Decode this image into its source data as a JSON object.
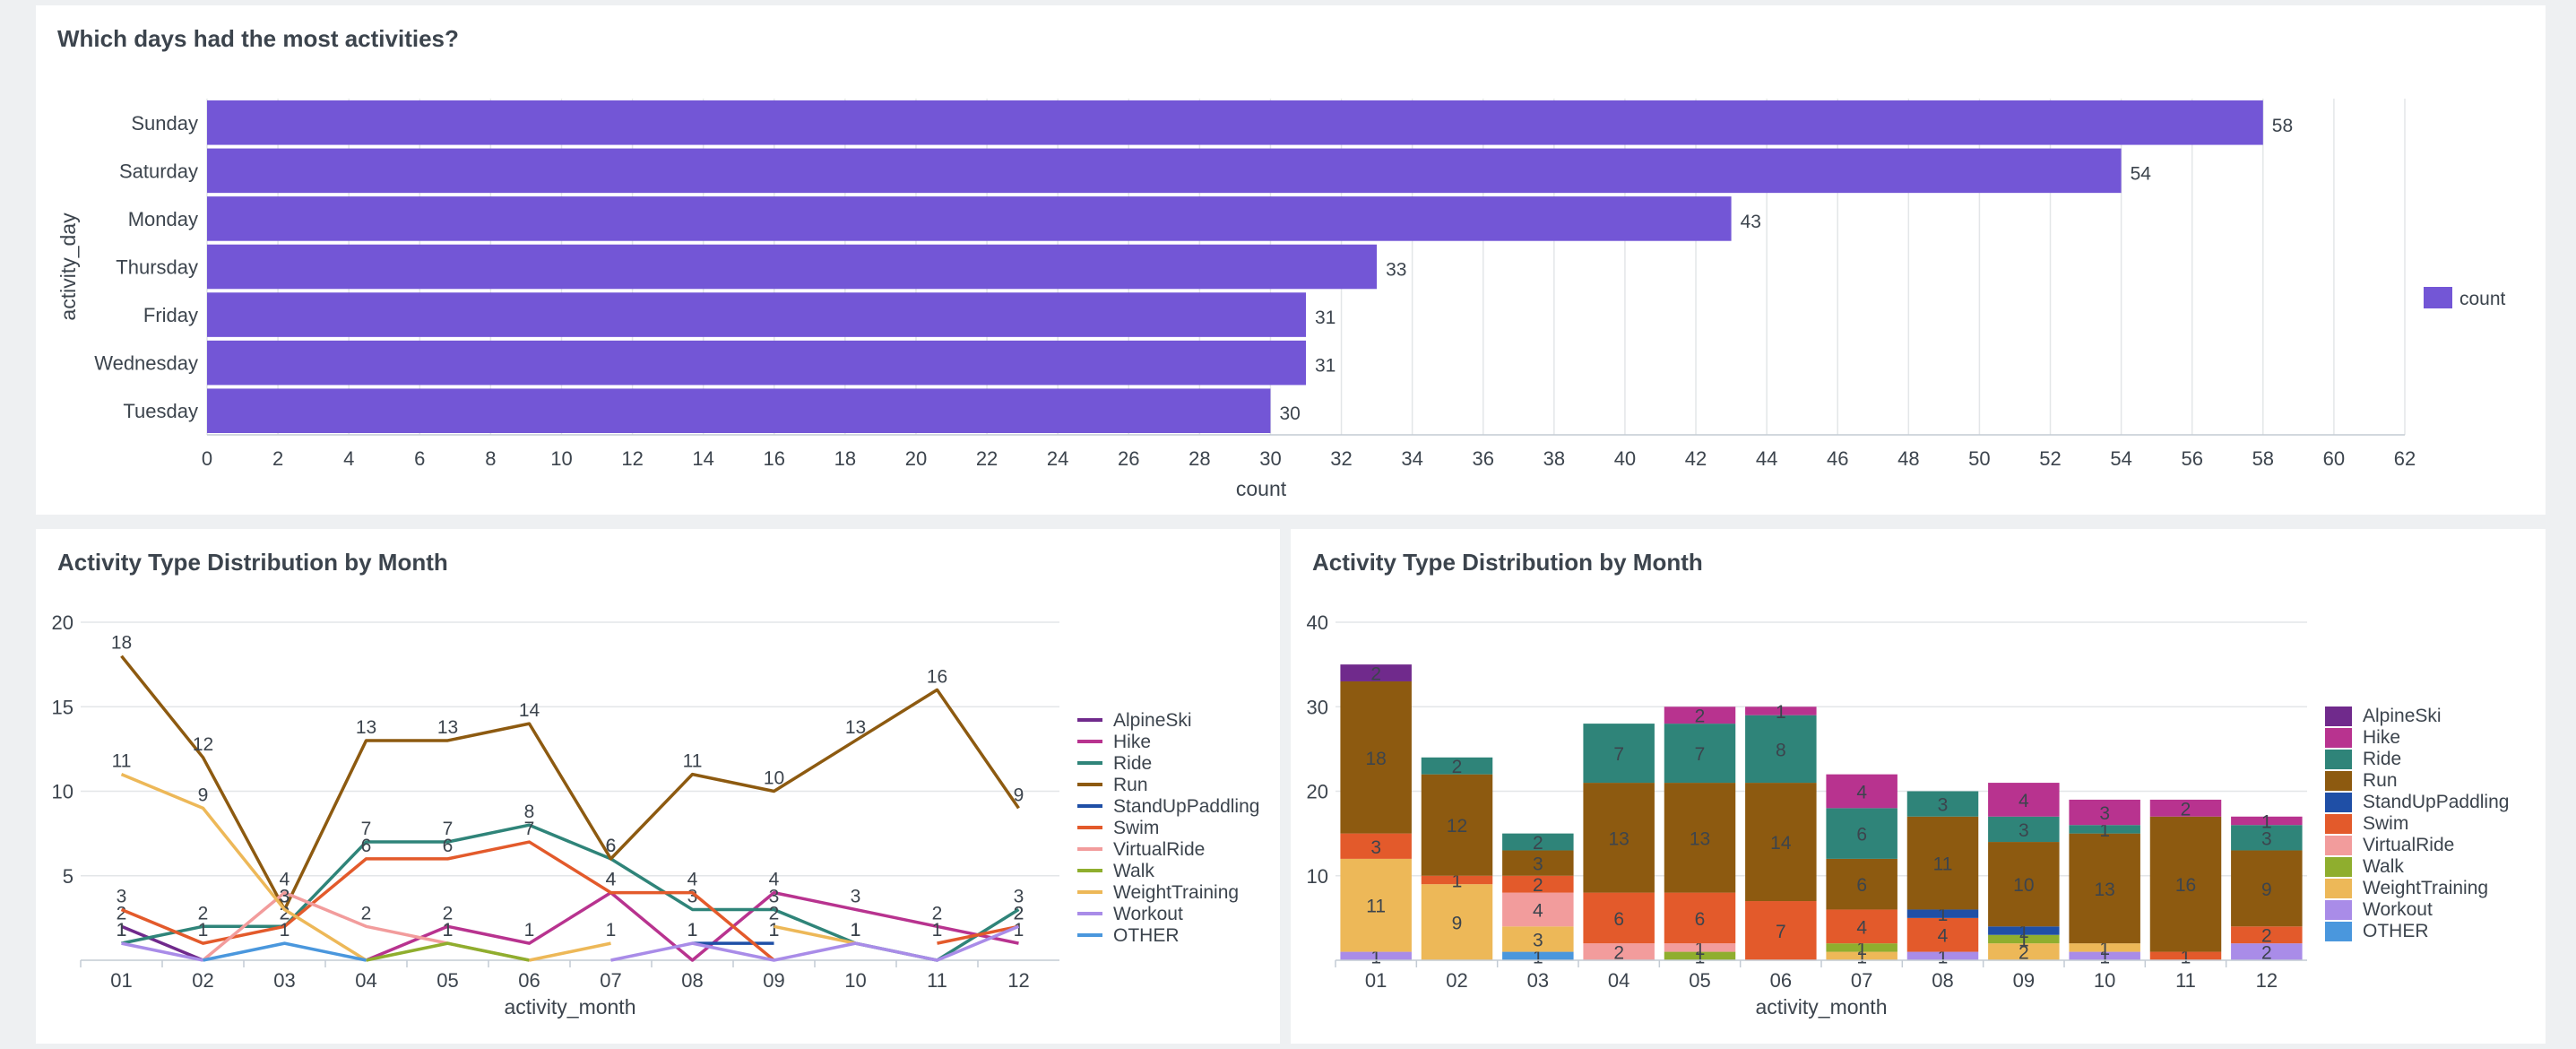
{
  "panels": {
    "top_title": "Which days had the most activities?",
    "left_title": "Activity Type Distribution by Month",
    "right_title": "Activity Type Distribution by Month"
  },
  "chart_data": [
    {
      "type": "bar",
      "orientation": "horizontal",
      "title": "Which days had the most activities?",
      "categories": [
        "Sunday",
        "Saturday",
        "Monday",
        "Thursday",
        "Friday",
        "Wednesday",
        "Tuesday"
      ],
      "values": [
        58,
        54,
        43,
        33,
        31,
        31,
        30
      ],
      "series_name": "count",
      "color": "#7356d6",
      "xlabel": "count",
      "ylabel": "activity_day",
      "xlim": [
        0,
        62
      ],
      "xticks": [
        0,
        2,
        4,
        6,
        8,
        10,
        12,
        14,
        16,
        18,
        20,
        22,
        24,
        26,
        28,
        30,
        32,
        34,
        36,
        38,
        40,
        42,
        44,
        46,
        48,
        50,
        52,
        54,
        56,
        58,
        60,
        62
      ],
      "grid": true,
      "legend": "right"
    },
    {
      "type": "line",
      "title": "Activity Type Distribution by Month",
      "categories": [
        "01",
        "02",
        "03",
        "04",
        "05",
        "06",
        "07",
        "08",
        "09",
        "10",
        "11",
        "12"
      ],
      "xlabel": "activity_month",
      "ylabel": "",
      "ylim": [
        0,
        20
      ],
      "yticks": [
        5,
        10,
        15,
        20
      ],
      "grid": true,
      "legend": "right",
      "series": [
        {
          "name": "AlpineSki",
          "color": "#702a8c",
          "values": [
            2,
            0,
            null,
            null,
            null,
            null,
            null,
            null,
            null,
            null,
            null,
            null
          ]
        },
        {
          "name": "Hike",
          "color": "#b8338f",
          "values": [
            null,
            null,
            null,
            0,
            2,
            1,
            4,
            0,
            4,
            3,
            2,
            1
          ]
        },
        {
          "name": "Ride",
          "color": "#2f8479",
          "values": [
            1,
            2,
            2,
            7,
            7,
            8,
            6,
            3,
            3,
            1,
            0,
            3
          ]
        },
        {
          "name": "Run",
          "color": "#8d5a10",
          "values": [
            18,
            12,
            3,
            13,
            13,
            14,
            6,
            11,
            10,
            13,
            16,
            9
          ]
        },
        {
          "name": "StandUpPaddling",
          "color": "#1f4fa6",
          "values": [
            null,
            null,
            null,
            null,
            null,
            null,
            null,
            1,
            1,
            null,
            null,
            null
          ]
        },
        {
          "name": "Swim",
          "color": "#e35a2b",
          "values": [
            3,
            1,
            2,
            6,
            6,
            7,
            4,
            4,
            0,
            null,
            1,
            2
          ]
        },
        {
          "name": "VirtualRide",
          "color": "#f29c9c",
          "values": [
            null,
            0,
            4,
            2,
            1,
            0,
            null,
            null,
            null,
            null,
            null,
            null
          ]
        },
        {
          "name": "Walk",
          "color": "#8fae2e",
          "values": [
            null,
            null,
            null,
            0,
            1,
            0,
            null,
            null,
            1,
            null,
            null,
            null
          ]
        },
        {
          "name": "WeightTraining",
          "color": "#edb858",
          "values": [
            11,
            9,
            3,
            0,
            null,
            0,
            1,
            null,
            2,
            1,
            null,
            null
          ]
        },
        {
          "name": "Workout",
          "color": "#a98ce8",
          "values": [
            1,
            0,
            null,
            null,
            null,
            null,
            0,
            1,
            0,
            1,
            0,
            2
          ]
        },
        {
          "name": "OTHER",
          "color": "#4a97dd",
          "values": [
            null,
            0,
            1,
            0,
            null,
            null,
            null,
            null,
            null,
            null,
            null,
            null
          ]
        }
      ]
    },
    {
      "type": "bar",
      "stacked": true,
      "title": "Activity Type Distribution by Month",
      "categories": [
        "01",
        "02",
        "03",
        "04",
        "05",
        "06",
        "07",
        "08",
        "09",
        "10",
        "11",
        "12"
      ],
      "xlabel": "activity_month",
      "ylabel": "",
      "ylim": [
        0,
        40
      ],
      "yticks": [
        10,
        20,
        30,
        40
      ],
      "grid": true,
      "legend": "right",
      "series": [
        {
          "name": "AlpineSki",
          "color": "#702a8c",
          "values": [
            2,
            0,
            0,
            0,
            0,
            0,
            0,
            0,
            0,
            0,
            0,
            0
          ]
        },
        {
          "name": "Hike",
          "color": "#b8338f",
          "values": [
            0,
            0,
            0,
            0,
            2,
            1,
            4,
            0,
            4,
            3,
            2,
            1
          ]
        },
        {
          "name": "Ride",
          "color": "#2f8479",
          "values": [
            0,
            2,
            2,
            7,
            7,
            8,
            6,
            3,
            3,
            1,
            0,
            3
          ]
        },
        {
          "name": "Run",
          "color": "#8d5a10",
          "values": [
            18,
            12,
            3,
            13,
            13,
            14,
            6,
            11,
            10,
            13,
            16,
            9
          ]
        },
        {
          "name": "StandUpPaddling",
          "color": "#1f4fa6",
          "values": [
            0,
            0,
            0,
            0,
            0,
            0,
            0,
            1,
            1,
            0,
            0,
            0
          ]
        },
        {
          "name": "Swim",
          "color": "#e35a2b",
          "values": [
            3,
            1,
            2,
            6,
            6,
            7,
            4,
            4,
            0,
            0,
            1,
            2
          ]
        },
        {
          "name": "VirtualRide",
          "color": "#f29c9c",
          "values": [
            0,
            0,
            4,
            2,
            1,
            0,
            0,
            0,
            0,
            0,
            0,
            0
          ]
        },
        {
          "name": "Walk",
          "color": "#8fae2e",
          "values": [
            0,
            0,
            0,
            0,
            1,
            0,
            1,
            0,
            1,
            0,
            0,
            0
          ]
        },
        {
          "name": "WeightTraining",
          "color": "#edb858",
          "values": [
            11,
            9,
            3,
            0,
            0,
            0,
            1,
            0,
            2,
            1,
            0,
            0
          ]
        },
        {
          "name": "Workout",
          "color": "#a98ce8",
          "values": [
            1,
            0,
            0,
            0,
            0,
            0,
            0,
            1,
            0,
            1,
            0,
            2
          ]
        },
        {
          "name": "OTHER",
          "color": "#4a97dd",
          "values": [
            0,
            0,
            1,
            0,
            0,
            0,
            0,
            0,
            0,
            0,
            0,
            0
          ]
        }
      ]
    }
  ]
}
